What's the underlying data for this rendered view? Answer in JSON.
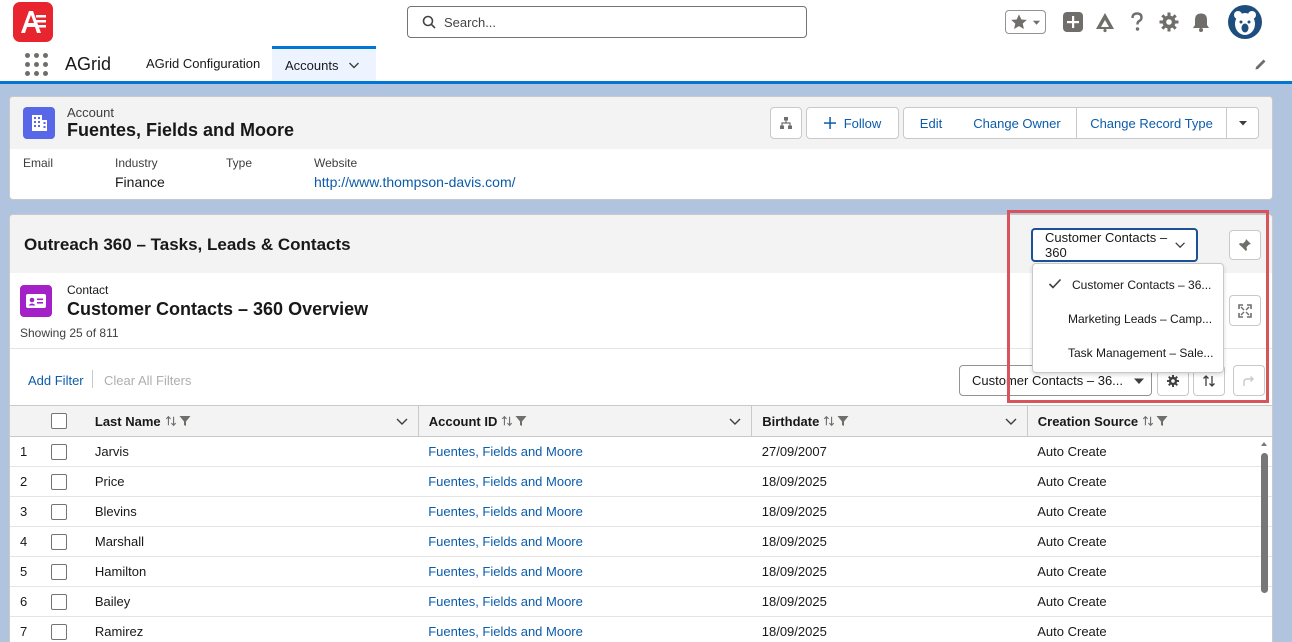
{
  "header": {
    "search_placeholder": "Search...",
    "icons": [
      "favorites-star-icon",
      "add-icon",
      "trailhead-icon",
      "help-icon",
      "setup-gear-icon",
      "notifications-bell-icon",
      "user-avatar"
    ]
  },
  "nav": {
    "app_name": "AGrid",
    "tabs": [
      {
        "label": "AGrid Configuration"
      },
      {
        "label": "Accounts",
        "active": true
      }
    ]
  },
  "record": {
    "object_label": "Account",
    "title": "Fuentes, Fields and Moore",
    "buttons": {
      "follow": "Follow",
      "edit": "Edit",
      "change_owner": "Change Owner",
      "change_record_type": "Change Record Type"
    },
    "fields": {
      "email": {
        "label": "Email",
        "value": ""
      },
      "industry": {
        "label": "Industry",
        "value": "Finance"
      },
      "type": {
        "label": "Type",
        "value": ""
      },
      "website": {
        "label": "Website",
        "value": "http://www.thompson-davis.com/"
      }
    }
  },
  "outreach": {
    "title": "Outreach 360 – Tasks, Leads & Contacts",
    "view_selected": "Customer Contacts – 360",
    "dropdown_options": [
      {
        "label": "Customer Contacts – 36...",
        "selected": true
      },
      {
        "label": "Marketing Leads – Camp...",
        "selected": false
      },
      {
        "label": "Task Management – Sale...",
        "selected": false
      }
    ]
  },
  "grid": {
    "object_label": "Contact",
    "title": "Customer Contacts – 360 Overview",
    "showing": "Showing 25 of 811",
    "add_filter": "Add Filter",
    "clear_filters": "Clear All Filters",
    "view_select": "Customer Contacts – 36...",
    "columns": [
      "Last Name",
      "Account ID",
      "Birthdate",
      "Creation Source"
    ],
    "rows": [
      {
        "num": "1",
        "last_name": "Jarvis",
        "account": "Fuentes, Fields and Moore",
        "birthdate": "27/09/2007",
        "source": "Auto Create"
      },
      {
        "num": "2",
        "last_name": "Price",
        "account": "Fuentes, Fields and Moore",
        "birthdate": "18/09/2025",
        "source": "Auto Create"
      },
      {
        "num": "3",
        "last_name": "Blevins",
        "account": "Fuentes, Fields and Moore",
        "birthdate": "18/09/2025",
        "source": "Auto Create"
      },
      {
        "num": "4",
        "last_name": "Marshall",
        "account": "Fuentes, Fields and Moore",
        "birthdate": "18/09/2025",
        "source": "Auto Create"
      },
      {
        "num": "5",
        "last_name": "Hamilton",
        "account": "Fuentes, Fields and Moore",
        "birthdate": "18/09/2025",
        "source": "Auto Create"
      },
      {
        "num": "6",
        "last_name": "Bailey",
        "account": "Fuentes, Fields and Moore",
        "birthdate": "18/09/2025",
        "source": "Auto Create"
      },
      {
        "num": "7",
        "last_name": "Ramirez",
        "account": "Fuentes, Fields and Moore",
        "birthdate": "18/09/2025",
        "source": "Auto Create"
      }
    ]
  },
  "colors": {
    "brand_blue": "#0176d3",
    "link": "#0b5cab",
    "highlight": "#d9535a",
    "account_icon": "#5867e8",
    "contact_icon": "#a321c6",
    "logo": "#e8252e"
  }
}
